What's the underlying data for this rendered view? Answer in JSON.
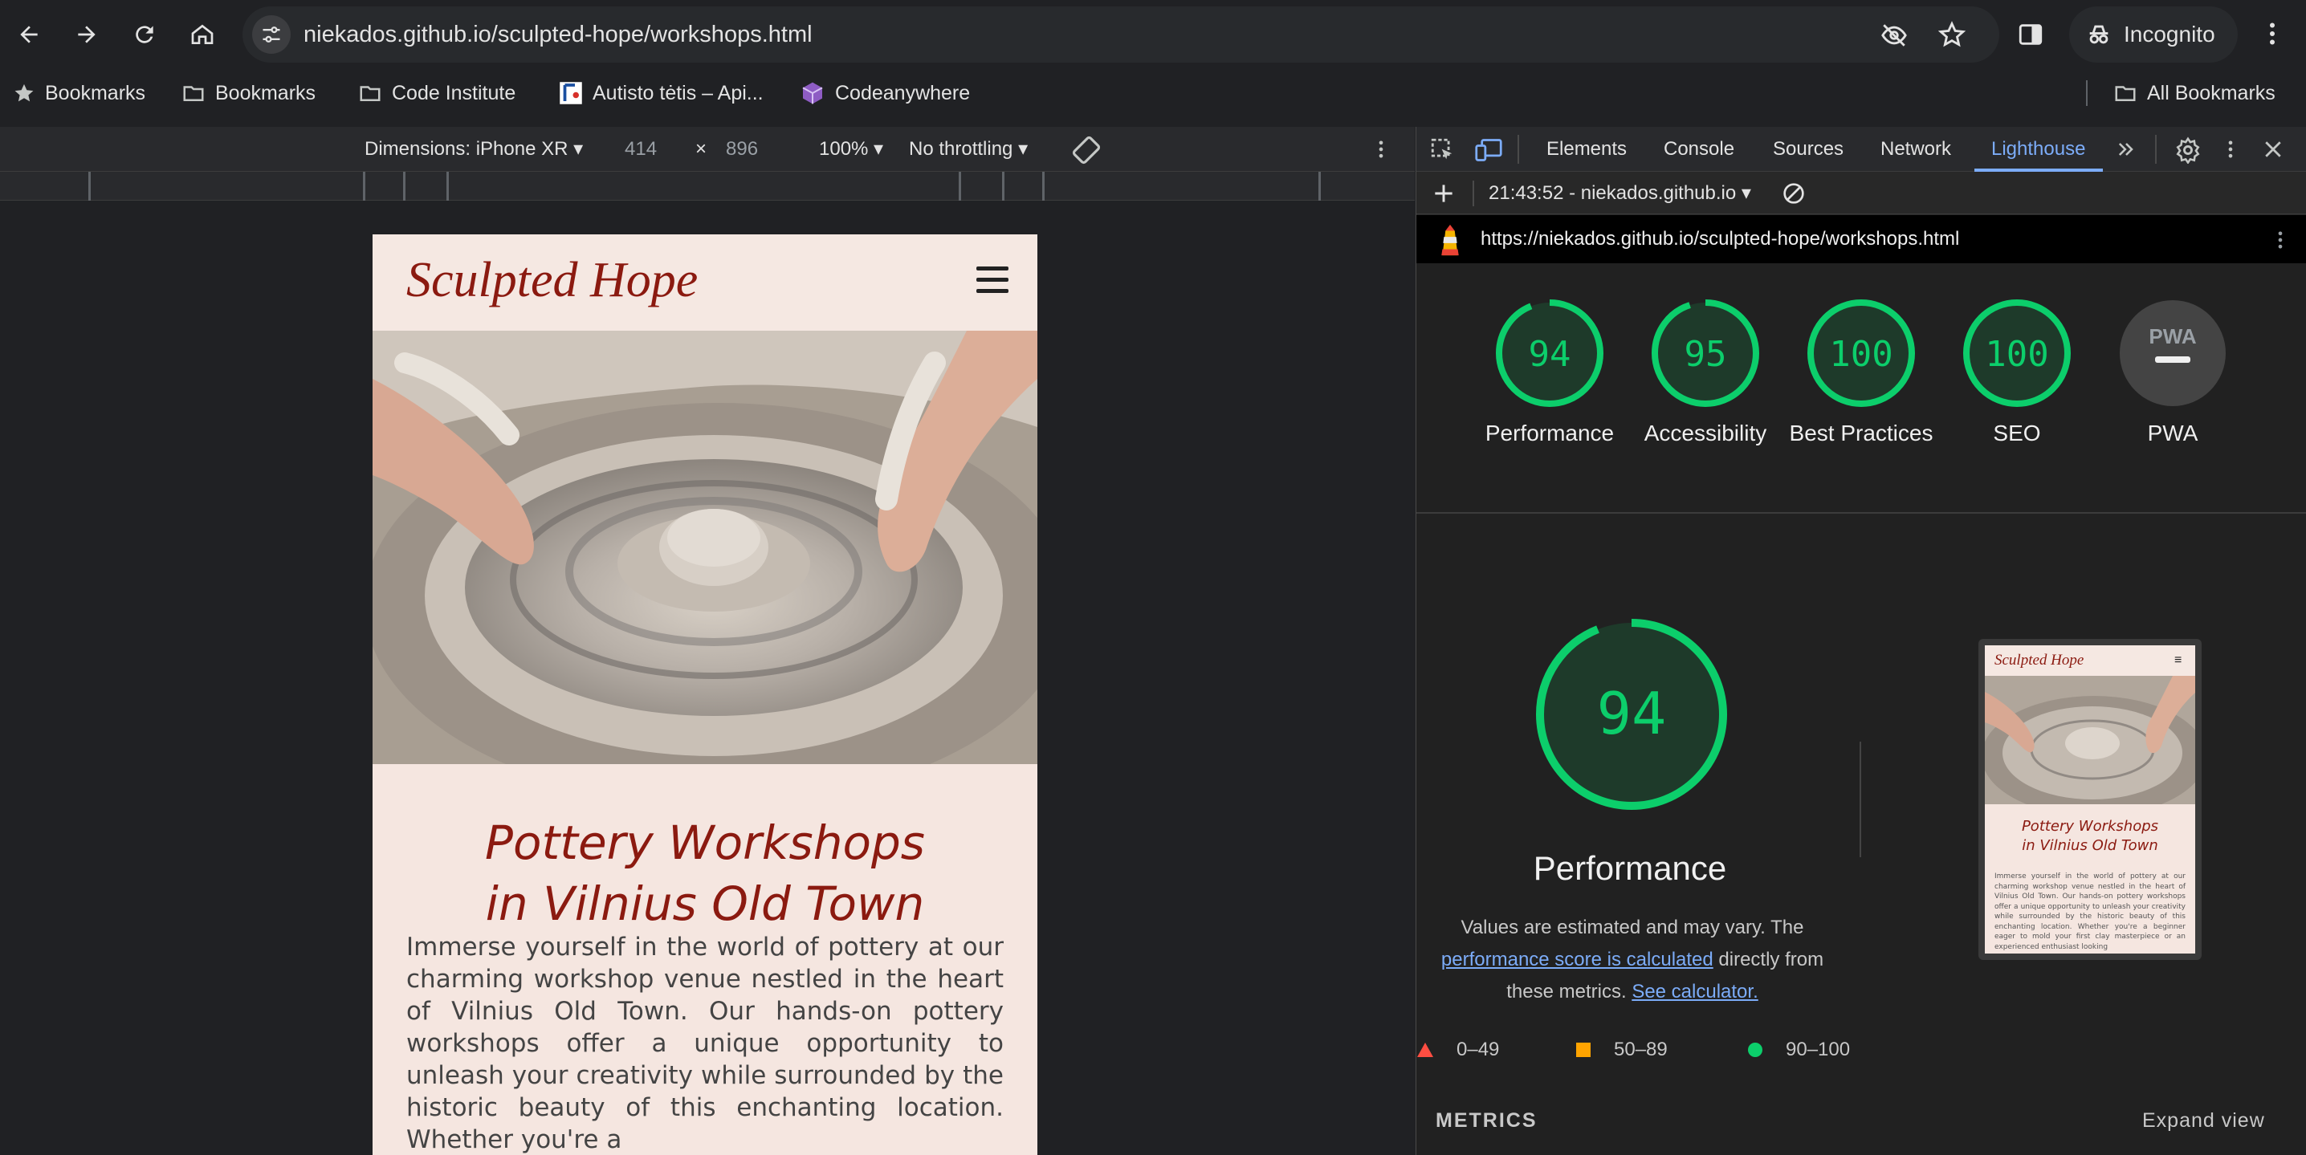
{
  "browser": {
    "url": "niekados.github.io/sculpted-hope/workshops.html",
    "profile_label": "Incognito",
    "bookmarks": [
      {
        "label": "Bookmarks",
        "icon": "star-icon"
      },
      {
        "label": "Bookmarks",
        "icon": "folder-icon"
      },
      {
        "label": "Code Institute",
        "icon": "folder-icon"
      },
      {
        "label": "Autisto tėtis – Api...",
        "icon": "site-favicon"
      },
      {
        "label": "Codeanywhere",
        "icon": "cube-icon"
      }
    ],
    "all_bookmarks_label": "All Bookmarks"
  },
  "device_toolbar": {
    "dimensions_label": "Dimensions: iPhone XR",
    "width": "414",
    "times": "×",
    "height": "896",
    "zoom": "100%",
    "throttling": "No throttling"
  },
  "site": {
    "brand": "Sculpted Hope",
    "heading_line1": "Pottery Workshops",
    "heading_line2": "in Vilnius Old Town",
    "paragraph": "Immerse yourself in the world of pottery at our charming workshop venue nestled in the heart of Vilnius Old Town. Our hands-on pottery workshops offer a unique opportunity to unleash your creativity while surrounded by the historic beauty of this enchanting location. Whether you're a"
  },
  "devtools": {
    "tabs": [
      "Elements",
      "Console",
      "Sources",
      "Network",
      "Lighthouse"
    ],
    "active_tab": "Lighthouse",
    "report_time": "21:43:52 - niekados.github.io",
    "report_url": "https://niekados.github.io/sculpted-hope/workshops.html",
    "scores": [
      {
        "label": "Performance",
        "value": "94"
      },
      {
        "label": "Accessibility",
        "value": "95"
      },
      {
        "label": "Best Practices",
        "value": "100"
      },
      {
        "label": "SEO",
        "value": "100"
      },
      {
        "label": "PWA",
        "value": ""
      }
    ],
    "pwa_badge": "PWA",
    "performance": {
      "score": "94",
      "title": "Performance",
      "desc_part1": "Values are estimated and may vary. The",
      "link1": "performance score is calculated",
      "desc_part2": "directly from",
      "desc_part3": "these metrics.",
      "link2": "See calculator."
    },
    "thumbnail": {
      "brand": "Sculpted Hope",
      "heading_line1": "Pottery Workshops",
      "heading_line2": "in Vilnius Old Town",
      "paragraph": "Immerse yourself in the world of pottery at our charming workshop venue nestled in the heart of Vilnius Old Town. Our hands-on pottery workshops offer a unique opportunity to unleash your creativity while surrounded by the historic beauty of this enchanting location. Whether you're a beginner eager to mold your first clay masterpiece or an experienced enthusiast looking"
    },
    "legend": [
      {
        "range": "0–49",
        "color": "#ff4e42"
      },
      {
        "range": "50–89",
        "color": "#ffa400"
      },
      {
        "range": "90–100",
        "color": "#0cce6b"
      }
    ],
    "metrics_label": "METRICS",
    "expand_label": "Expand view"
  },
  "colors": {
    "pass": "#0cce6b",
    "link": "#7cacf8",
    "brand": "#8b1a10"
  }
}
